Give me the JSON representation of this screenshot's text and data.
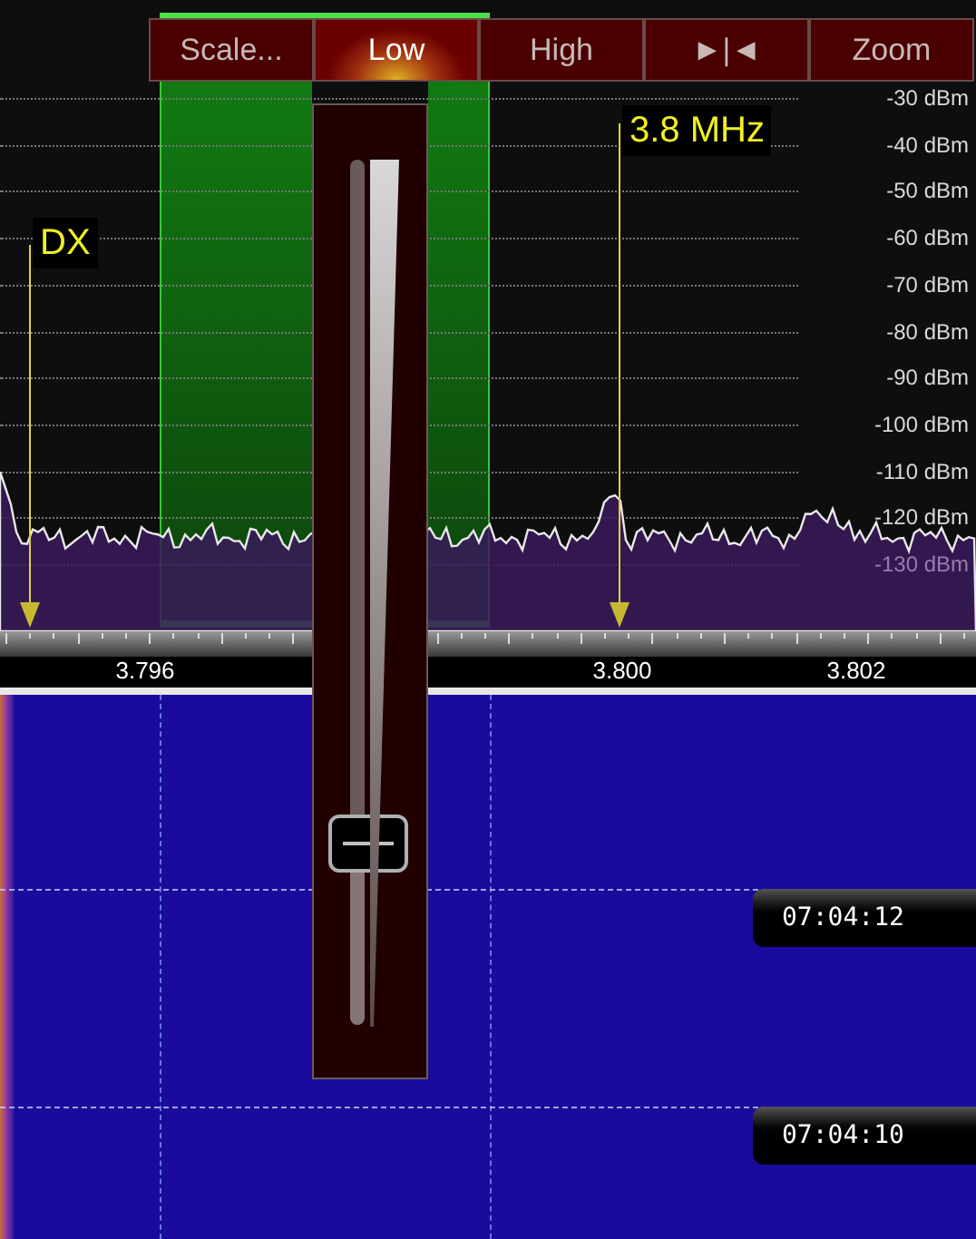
{
  "toolbar": {
    "buttons": [
      {
        "label": "Scale...",
        "selected": false
      },
      {
        "label": "Low",
        "selected": true
      },
      {
        "label": "High",
        "selected": false
      },
      {
        "label": "►|◄",
        "selected": false
      },
      {
        "label": "Zoom",
        "selected": false
      }
    ]
  },
  "spectrum": {
    "db_labels": [
      "-30 dBm",
      "-40 dBm",
      "-50 dBm",
      "-60 dBm",
      "-70 dBm",
      "-80 dBm",
      "-90 dBm",
      "-100 dBm",
      "-110 dBm",
      "-120 dBm",
      "-130 dBm"
    ],
    "markers": [
      {
        "label": "DX"
      },
      {
        "label": "3.8 MHz"
      }
    ]
  },
  "frequency_axis": {
    "labels": [
      "3.796",
      "3.800",
      "3.802"
    ]
  },
  "slider": {
    "level": 0.21
  },
  "waterfall": {
    "time_labels": [
      "07:04:12",
      "07:04:10"
    ]
  }
}
